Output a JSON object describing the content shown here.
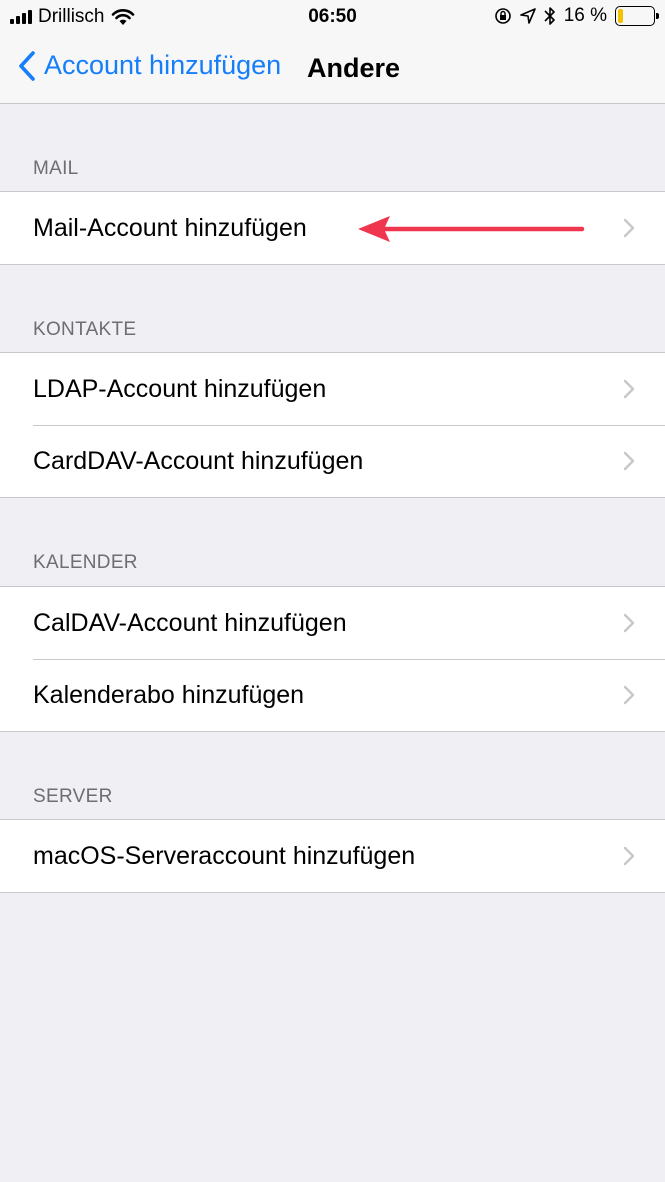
{
  "status_bar": {
    "carrier": "Drillisch",
    "time": "06:50",
    "battery_percent": "16 %",
    "battery_level": 0.16,
    "icons": [
      "signal-icon",
      "wifi-icon",
      "orientation-lock-icon",
      "location-icon",
      "bluetooth-icon",
      "battery-icon"
    ]
  },
  "navbar": {
    "back_label": "Account hinzufügen",
    "title": "Andere"
  },
  "sections": [
    {
      "header": "MAIL",
      "rows": [
        "Mail-Account hinzufügen"
      ]
    },
    {
      "header": "KONTAKTE",
      "rows": [
        "LDAP-Account hinzufügen",
        "CardDAV-Account hinzufügen"
      ]
    },
    {
      "header": "KALENDER",
      "rows": [
        "CalDAV-Account hinzufügen",
        "Kalenderabo hinzufügen"
      ]
    },
    {
      "header": "SERVER",
      "rows": [
        "macOS-Serveraccount hinzufügen"
      ]
    }
  ],
  "colors": {
    "accent": "#157efb",
    "annotation_arrow": "#f0364f",
    "background": "#efeff4"
  }
}
